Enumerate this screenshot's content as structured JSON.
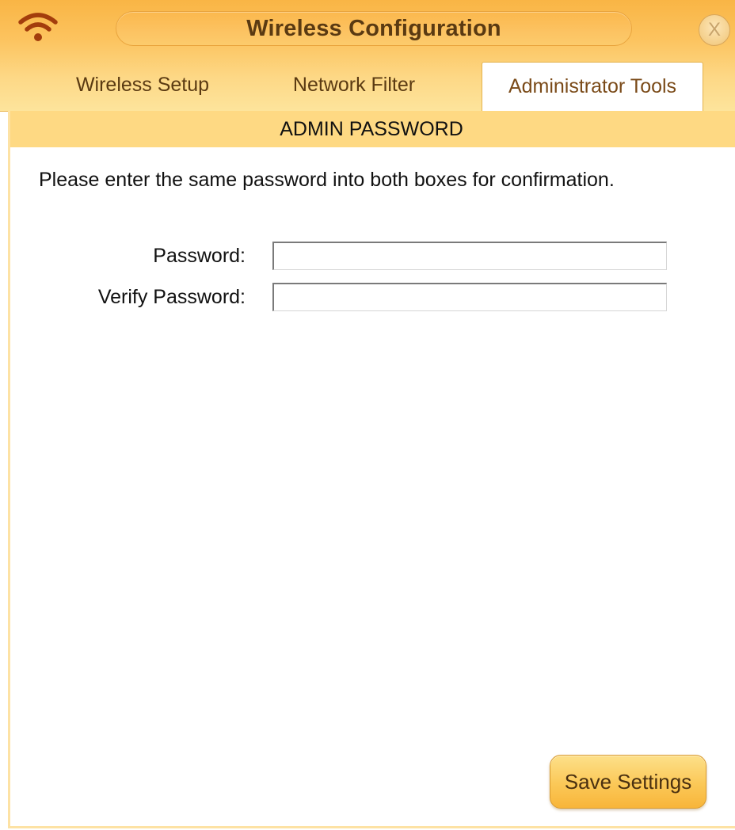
{
  "window": {
    "title": "Wireless Configuration",
    "close_label": "X"
  },
  "tabs": [
    {
      "label": "Wireless Setup",
      "active": false
    },
    {
      "label": "Network Filter",
      "active": false
    },
    {
      "label": "Administrator Tools",
      "active": true
    }
  ],
  "section": {
    "title": "ADMIN PASSWORD",
    "instruction": "Please enter the same password into both boxes for confirmation."
  },
  "form": {
    "password_label": "Password:",
    "password_value": "",
    "verify_label": "Verify Password:",
    "verify_value": ""
  },
  "actions": {
    "save_label": "Save Settings"
  },
  "icons": {
    "window": "wifi-icon",
    "close": "close-icon"
  },
  "colors": {
    "header_orange": "#fbb84d",
    "section_bar": "#fed983",
    "text_brown": "#5a3a12",
    "wifi_icon": "#a33d0c"
  }
}
